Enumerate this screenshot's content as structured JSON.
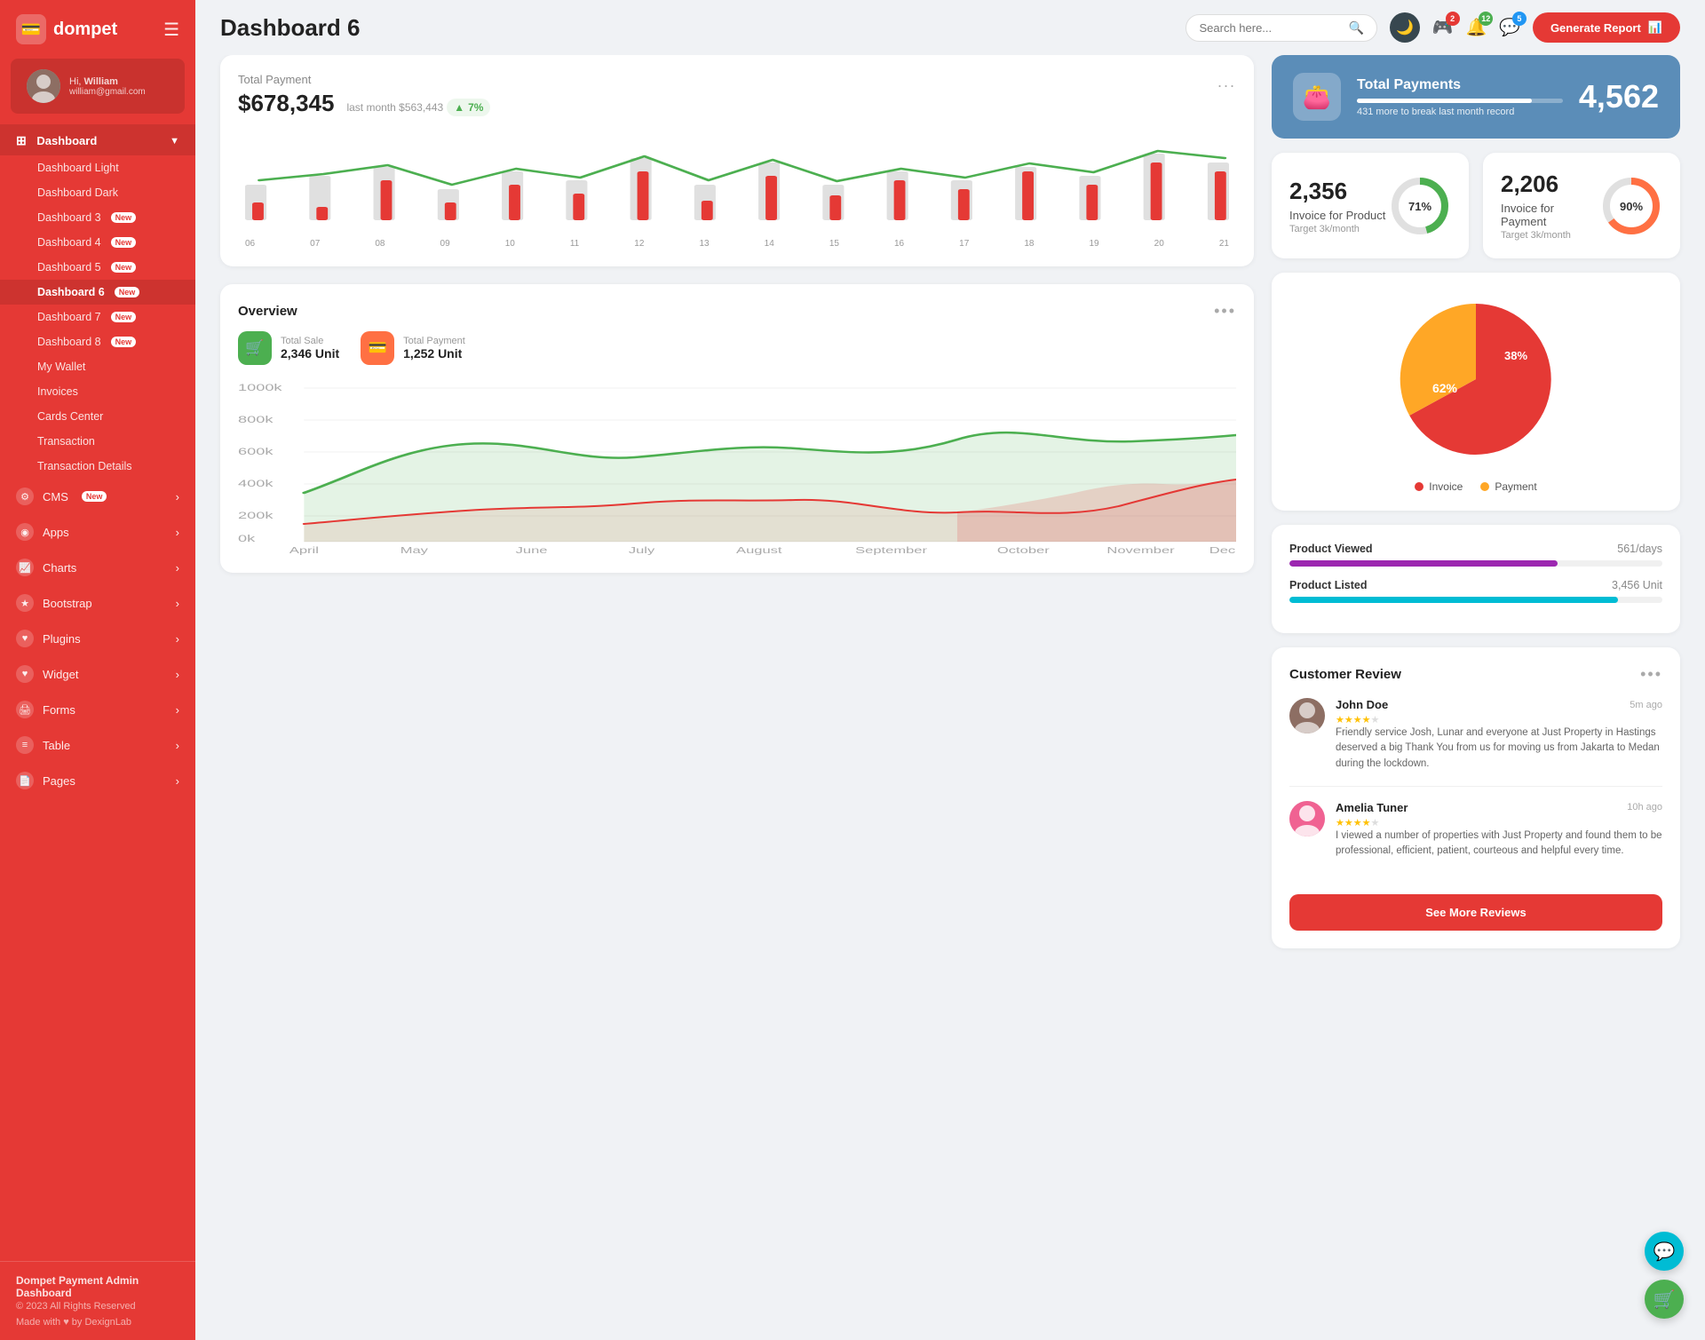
{
  "sidebar": {
    "logo": "dompet",
    "profile": {
      "greeting": "Hi,",
      "name": "William",
      "email": "william@gmail.com"
    },
    "dashboard_section": "Dashboard",
    "dashboard_items": [
      {
        "label": "Dashboard Light",
        "active": false
      },
      {
        "label": "Dashboard Dark",
        "active": false
      },
      {
        "label": "Dashboard 3",
        "active": false,
        "badge": "New"
      },
      {
        "label": "Dashboard 4",
        "active": false,
        "badge": "New"
      },
      {
        "label": "Dashboard 5",
        "active": false,
        "badge": "New"
      },
      {
        "label": "Dashboard 6",
        "active": true,
        "badge": "New"
      },
      {
        "label": "Dashboard 7",
        "active": false,
        "badge": "New"
      },
      {
        "label": "Dashboard 8",
        "active": false,
        "badge": "New"
      },
      {
        "label": "My Wallet",
        "active": false
      },
      {
        "label": "Invoices",
        "active": false
      },
      {
        "label": "Cards Center",
        "active": false
      },
      {
        "label": "Transaction",
        "active": false
      },
      {
        "label": "Transaction Details",
        "active": false
      }
    ],
    "nav_items": [
      {
        "label": "CMS",
        "icon": "⚙",
        "badge": "New",
        "has_arrow": true
      },
      {
        "label": "Apps",
        "icon": "◉",
        "has_arrow": true
      },
      {
        "label": "Charts",
        "icon": "📈",
        "has_arrow": true
      },
      {
        "label": "Bootstrap",
        "icon": "★",
        "has_arrow": true
      },
      {
        "label": "Plugins",
        "icon": "♥",
        "has_arrow": true
      },
      {
        "label": "Widget",
        "icon": "♥",
        "has_arrow": true
      },
      {
        "label": "Forms",
        "icon": "🖨",
        "has_arrow": true
      },
      {
        "label": "Table",
        "icon": "≡",
        "has_arrow": true
      },
      {
        "label": "Pages",
        "icon": "📄",
        "has_arrow": true
      }
    ],
    "footer": {
      "brand": "Dompet Payment Admin Dashboard",
      "copyright": "© 2023 All Rights Reserved",
      "made_with": "Made with ♥ by DexignLab"
    }
  },
  "topbar": {
    "title": "Dashboard 6",
    "search_placeholder": "Search here...",
    "notifications": [
      {
        "count": 2,
        "color": "red"
      },
      {
        "count": 12,
        "color": "green"
      },
      {
        "count": 5,
        "color": "blue"
      }
    ],
    "generate_btn": "Generate Report"
  },
  "total_payment": {
    "label": "Total Payment",
    "amount": "$678,345",
    "last_month": "last month $563,443",
    "trend": "7%",
    "trend_up": true,
    "more_label": "...",
    "bar_labels": [
      "06",
      "07",
      "08",
      "09",
      "10",
      "11",
      "12",
      "13",
      "14",
      "15",
      "16",
      "17",
      "18",
      "19",
      "20",
      "21"
    ],
    "bars": [
      {
        "light": 40,
        "red": 25
      },
      {
        "light": 50,
        "red": 15
      },
      {
        "light": 60,
        "red": 45
      },
      {
        "light": 30,
        "red": 20
      },
      {
        "light": 55,
        "red": 40
      },
      {
        "light": 45,
        "red": 30
      },
      {
        "light": 70,
        "red": 55
      },
      {
        "light": 35,
        "red": 22
      },
      {
        "light": 65,
        "red": 50
      },
      {
        "light": 40,
        "red": 28
      },
      {
        "light": 55,
        "red": 45
      },
      {
        "light": 45,
        "red": 35
      },
      {
        "light": 60,
        "red": 55
      },
      {
        "light": 50,
        "red": 40
      },
      {
        "light": 75,
        "red": 65
      },
      {
        "light": 65,
        "red": 55
      }
    ]
  },
  "total_payments_widget": {
    "title": "Total Payments",
    "sub": "431 more to break last month record",
    "number": "4,562",
    "progress": 85
  },
  "invoice_product": {
    "number": "2,356",
    "label": "Invoice for Product",
    "sub": "Target 3k/month",
    "percent": 71,
    "color": "#4caf50"
  },
  "invoice_payment": {
    "number": "2,206",
    "label": "Invoice for Payment",
    "sub": "Target 3k/month",
    "percent": 90,
    "color": "#ff7043"
  },
  "overview": {
    "title": "Overview",
    "total_sale_label": "Total Sale",
    "total_sale_value": "2,346 Unit",
    "total_payment_label": "Total Payment",
    "total_payment_value": "1,252 Unit",
    "months": [
      "April",
      "May",
      "June",
      "July",
      "August",
      "September",
      "October",
      "November",
      "Dec."
    ],
    "y_labels": [
      "1000k",
      "800k",
      "600k",
      "400k",
      "200k",
      "0k"
    ]
  },
  "pie_chart": {
    "invoice_pct": 62,
    "payment_pct": 38,
    "invoice_label": "Invoice",
    "payment_label": "Payment",
    "invoice_color": "#e53935",
    "payment_color": "#ffa726"
  },
  "product_stats": {
    "viewed_label": "Product Viewed",
    "viewed_value": "561/days",
    "viewed_pct": 72,
    "viewed_color": "#9c27b0",
    "listed_label": "Product Listed",
    "listed_value": "3,456 Unit",
    "listed_pct": 88,
    "listed_color": "#00bcd4"
  },
  "customer_review": {
    "title": "Customer Review",
    "reviews": [
      {
        "name": "John Doe",
        "time": "5m ago",
        "stars": 4,
        "text": "Friendly service Josh, Lunar and everyone at Just Property in Hastings deserved a big Thank You from us for moving us from Jakarta to Medan during the lockdown."
      },
      {
        "name": "Amelia Tuner",
        "time": "10h ago",
        "stars": 4,
        "text": "I viewed a number of properties with Just Property and found them to be professional, efficient, patient, courteous and helpful every time."
      }
    ],
    "see_more_btn": "See More Reviews"
  }
}
